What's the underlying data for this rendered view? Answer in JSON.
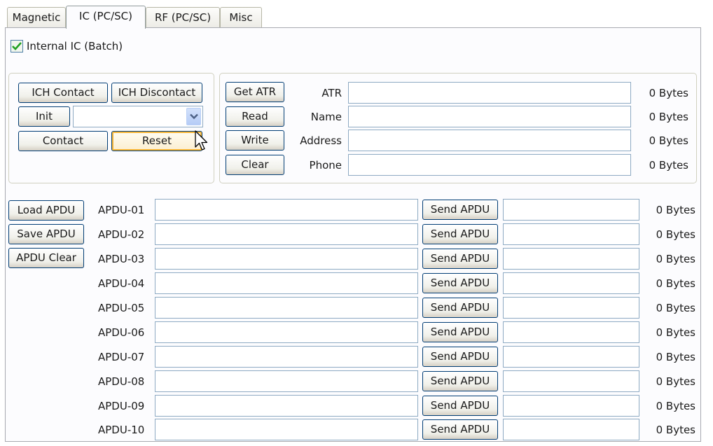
{
  "tabs": [
    {
      "label": "Magnetic",
      "active": false
    },
    {
      "label": "IC (PC/SC)",
      "active": true
    },
    {
      "label": "RF (PC/SC)",
      "active": false
    },
    {
      "label": "Misc",
      "active": false
    }
  ],
  "internal_ic": {
    "label": "Internal IC (Batch)",
    "checked": true
  },
  "control": {
    "ich_contact": "ICH Contact",
    "ich_discontact": "ICH Discontact",
    "init": "Init",
    "combo_value": "",
    "contact": "Contact",
    "reset": "Reset"
  },
  "card_info": [
    {
      "button": "Get ATR",
      "label": "ATR",
      "value": "",
      "bytes": "0 Bytes"
    },
    {
      "button": "Read",
      "label": "Name",
      "value": "",
      "bytes": "0 Bytes"
    },
    {
      "button": "Write",
      "label": "Address",
      "value": "",
      "bytes": "0 Bytes"
    },
    {
      "button": "Clear",
      "label": "Phone",
      "value": "",
      "bytes": "0 Bytes"
    }
  ],
  "apdu_buttons": {
    "load": "Load APDU",
    "save": "Save APDU",
    "clear": "APDU Clear"
  },
  "apdu_rows": [
    {
      "label": "APDU-01",
      "command": "",
      "send": "Send APDU",
      "response": "",
      "bytes": "0 Bytes"
    },
    {
      "label": "APDU-02",
      "command": "",
      "send": "Send APDU",
      "response": "",
      "bytes": "0 Bytes"
    },
    {
      "label": "APDU-03",
      "command": "",
      "send": "Send APDU",
      "response": "",
      "bytes": "0 Bytes"
    },
    {
      "label": "APDU-04",
      "command": "",
      "send": "Send APDU",
      "response": "",
      "bytes": "0 Bytes"
    },
    {
      "label": "APDU-05",
      "command": "",
      "send": "Send APDU",
      "response": "",
      "bytes": "0 Bytes"
    },
    {
      "label": "APDU-06",
      "command": "",
      "send": "Send APDU",
      "response": "",
      "bytes": "0 Bytes"
    },
    {
      "label": "APDU-07",
      "command": "",
      "send": "Send APDU",
      "response": "",
      "bytes": "0 Bytes"
    },
    {
      "label": "APDU-08",
      "command": "",
      "send": "Send APDU",
      "response": "",
      "bytes": "0 Bytes"
    },
    {
      "label": "APDU-09",
      "command": "",
      "send": "Send APDU",
      "response": "",
      "bytes": "0 Bytes"
    },
    {
      "label": "APDU-10",
      "command": "",
      "send": "Send APDU",
      "response": "",
      "bytes": "0 Bytes"
    }
  ],
  "colors": {
    "checkmark": "#21a121",
    "combo_arrow": "#4d6185"
  }
}
